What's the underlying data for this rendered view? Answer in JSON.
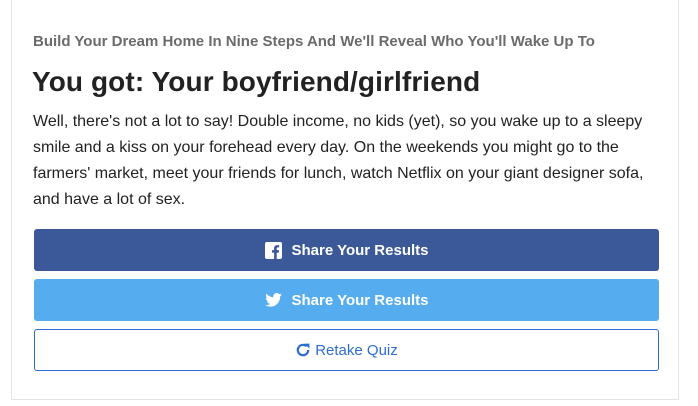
{
  "quiz": {
    "title": "Build Your Dream Home In Nine Steps And We'll Reveal Who You'll Wake Up To"
  },
  "result": {
    "heading": "You got: Your boyfriend/girlfriend",
    "description": "Well, there's not a lot to say! Double income, no kids (yet), so you wake up to a sleepy smile and a kiss on your forehead every day. On the weekends you might go to the farmers' market, meet your friends for lunch, watch Netflix on your giant designer sofa, and have a lot of sex."
  },
  "buttons": {
    "facebook": {
      "label": "Share Your Results",
      "icon": "facebook-icon",
      "color": "#3b5998"
    },
    "twitter": {
      "label": "Share Your Results",
      "icon": "twitter-icon",
      "color": "#55acee"
    },
    "retake": {
      "label": "Retake Quiz",
      "icon": "refresh-icon",
      "color": "#2d6dd2"
    }
  }
}
